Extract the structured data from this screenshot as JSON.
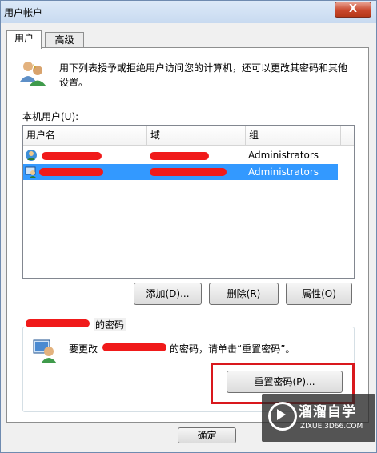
{
  "window": {
    "title": "用户帐户",
    "close_glyph": "X"
  },
  "tabs": [
    {
      "label": "用户"
    },
    {
      "label": "高级"
    }
  ],
  "intro": {
    "text": "用下列表授予或拒绝用户访问您的计算机，还可以更改其密码和其他设置。"
  },
  "users_section": {
    "label": "本机用户(U):"
  },
  "table": {
    "columns": [
      "用户名",
      "域",
      "组"
    ],
    "rows": [
      {
        "user": "",
        "domain": "",
        "group": "Administrators",
        "selected": false
      },
      {
        "user": "",
        "domain": "",
        "group": "Administrators",
        "selected": true
      }
    ]
  },
  "buttons": {
    "add": "添加(D)...",
    "remove": "删除(R)",
    "properties": "属性(O)",
    "reset_password": "重置密码(P)...",
    "ok": "确定"
  },
  "password_group": {
    "title_suffix": "的密码",
    "msg_prefix": "要更改",
    "msg_suffix": "的密码，请单击“重置密码”。"
  },
  "watermark": {
    "title": "溜溜自学",
    "subtitle": "ZIXUE.3D66.COM"
  },
  "colors": {
    "selection": "#3399ff",
    "highlight_box": "#d9181d",
    "redaction": "#f01a1a",
    "close_button": "#c9472c"
  }
}
